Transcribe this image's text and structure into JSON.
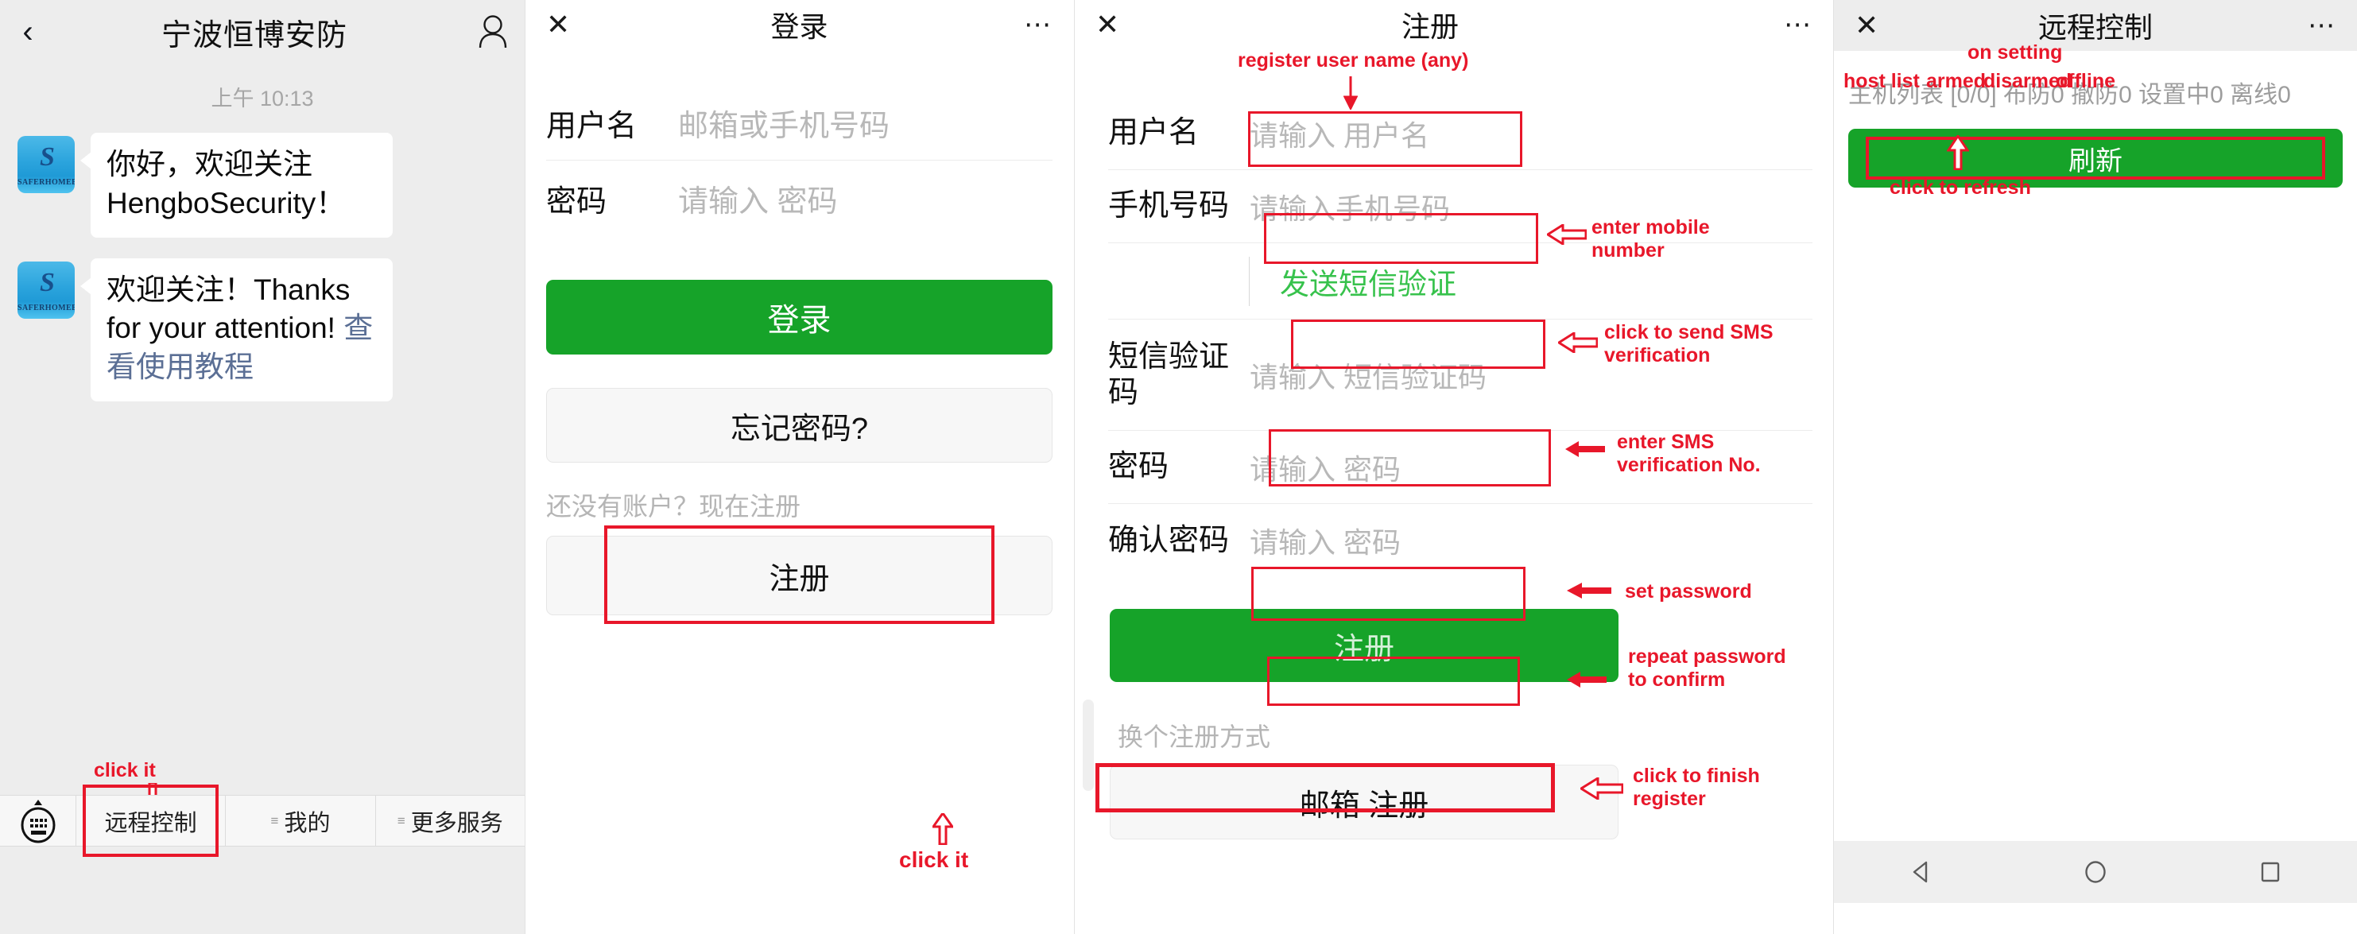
{
  "colors": {
    "wechat_green": "#16a329",
    "annotation_red": "#e8172a",
    "link_blue": "#5b6f95",
    "sms_green": "#37c24c"
  },
  "panel_chat": {
    "header": {
      "back_icon": "chevron-left-icon",
      "title": "宁波恒博安防",
      "contact_icon": "person-icon"
    },
    "timestamp": "上午 10:13",
    "messages": [
      {
        "avatar_logo": "S",
        "avatar_brand": "SAFERHOMEE",
        "text": "你好，欢迎关注HengboSecurity！"
      },
      {
        "avatar_logo": "S",
        "avatar_brand": "SAFERHOMEE",
        "text": "欢迎关注！Thanks for your attention! ",
        "link_text": "查看使用教程"
      }
    ],
    "toolbar": {
      "keyboard_icon": "keyboard-icon",
      "items": [
        {
          "label": "远程控制",
          "has_menu_dots": false,
          "highlighted": true
        },
        {
          "label": "我的",
          "has_menu_dots": true,
          "highlighted": false
        },
        {
          "label": "更多服务",
          "has_menu_dots": true,
          "highlighted": false
        }
      ]
    },
    "annotation": {
      "click_it": "click it"
    }
  },
  "panel_login": {
    "header": {
      "close_icon": "close-icon",
      "title": "登录",
      "more_icon": "more-dots-icon"
    },
    "fields": [
      {
        "label": "用户名",
        "placeholder": "邮箱或手机号码",
        "value": ""
      },
      {
        "label": "密码",
        "placeholder": "请输入 密码",
        "value": ""
      }
    ],
    "login_button": "登录",
    "forgot_button": "忘记密码?",
    "register_hint": "还没有账户？现在注册",
    "register_button": "注册",
    "annotation": {
      "click_it": "click it"
    }
  },
  "panel_register": {
    "header": {
      "close_icon": "close-icon",
      "title": "注册",
      "more_icon": "more-dots-icon"
    },
    "fields": [
      {
        "label": "用户名",
        "placeholder": "请输入 用户名",
        "value": ""
      },
      {
        "label": "手机号码",
        "placeholder": "请输入手机号码",
        "value": ""
      },
      {
        "label": "短信验证码",
        "placeholder": "请输入 短信验证码",
        "value": ""
      },
      {
        "label": "密码",
        "placeholder": "请输入 密码",
        "value": ""
      },
      {
        "label": "确认密码",
        "placeholder": "请输入 密码",
        "value": ""
      }
    ],
    "sms_button": "发送短信验证",
    "submit_button": "注册",
    "alt_label": "换个注册方式",
    "alt_button": "邮箱 注册",
    "annotations": {
      "username": "register user name (any)",
      "mobile": "enter mobile\nnumber",
      "sms_send": "click to send SMS\nverification",
      "sms_code": "enter SMS\nverification No.",
      "password": "set password",
      "confirm": "repeat password\nto confirm",
      "submit": "click to finish\nregister"
    }
  },
  "panel_remote": {
    "header": {
      "close_icon": "close-icon",
      "title": "远程控制",
      "more_icon": "more-dots-icon"
    },
    "status_line": "主机列表 [0/0] 布防0 撤防0 设置中0 离线0",
    "refresh_button": "刷新",
    "annotations": {
      "host_list": "host list",
      "armed": "armed",
      "disarmed": "disarmed",
      "on_setting": "on setting",
      "offline": "offline",
      "refresh": "click to refresh"
    },
    "android_nav": [
      "back-triangle-icon",
      "home-circle-icon",
      "recents-square-icon"
    ]
  }
}
